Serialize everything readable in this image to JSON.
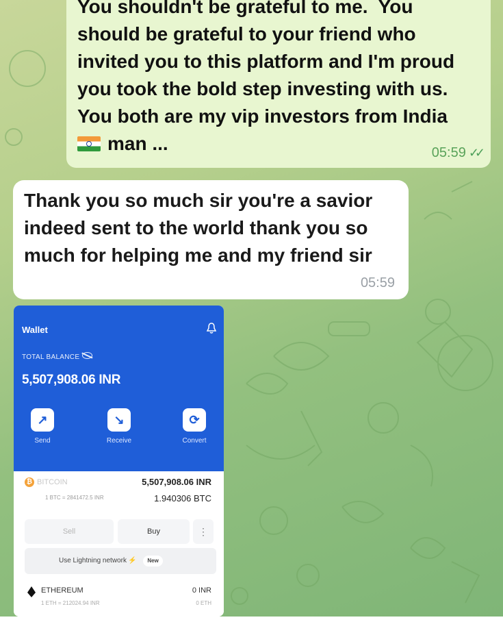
{
  "chat": {
    "outgoing": {
      "lines": [
        "You shouldn't be grateful to me.  You",
        "should be grateful to your friend who",
        "invited you to this platform and I'm proud",
        "you took the bold step investing with us.",
        "You both are my vip investors from India"
      ],
      "last_line": "man ...",
      "time": "05:59"
    },
    "incoming": {
      "lines": [
        "Thank you so much sir you're a savior",
        "indeed sent to the world thank you so",
        "much for helping me and my friend sir"
      ],
      "time": "05:59"
    }
  },
  "wallet": {
    "title": "Wallet",
    "total_balance_label": "TOTAL BALANCE",
    "balance": "5,507,908.06 INR",
    "actions": [
      {
        "label": "Send",
        "icon": "arrow-up-right-icon"
      },
      {
        "label": "Receive",
        "icon": "arrow-down-right-icon"
      },
      {
        "label": "Convert",
        "icon": "convert-icon"
      }
    ],
    "bitcoin": {
      "name": "BITCOIN",
      "rate": "1 BTC = 2841472.5 INR",
      "inr": "5,507,908.06 INR",
      "amount": "1.940306 BTC"
    },
    "buttons": {
      "sell": "Sell",
      "buy": "Buy",
      "more": "⋮"
    },
    "lightning": {
      "label": "Use Lightning network",
      "badge": "New"
    },
    "ethereum": {
      "name": "ETHEREUM",
      "rate": "1 ETH = 212024.94 INR",
      "inr": "0 INR",
      "amount": "0 ETH"
    }
  },
  "colors": {
    "wallet_blue": "#1f5ed8",
    "outgoing_bubble": "#e8f6d0",
    "incoming_bubble": "#ffffff",
    "chat_bg": "#a6c984"
  }
}
